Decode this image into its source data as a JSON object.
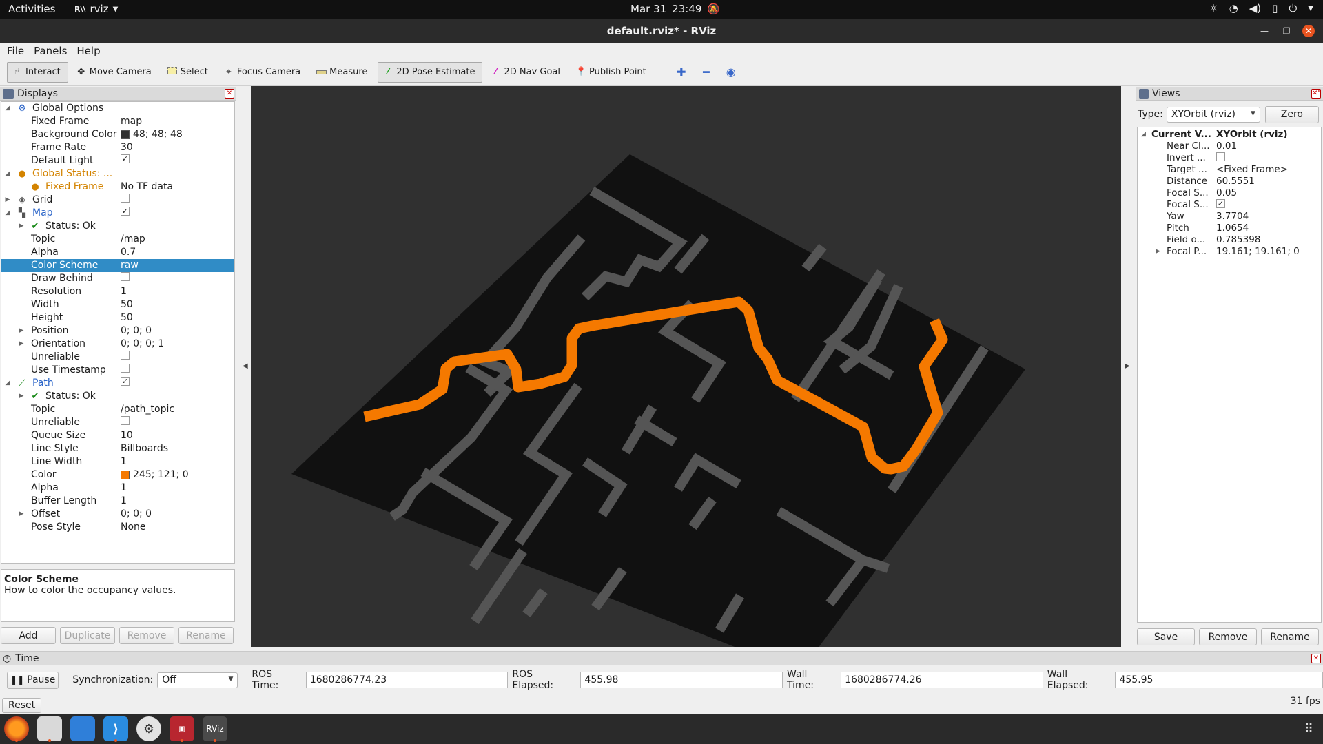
{
  "system": {
    "activities": "Activities",
    "app_name": "rviz",
    "date": "Mar 31",
    "time": "23:49"
  },
  "window": {
    "title": "default.rviz* - RViz"
  },
  "menu": [
    "File",
    "Panels",
    "Help"
  ],
  "toolbar": {
    "tools": [
      {
        "label": "Interact",
        "icon": "hand-icon"
      },
      {
        "label": "Move Camera",
        "icon": "move-camera-icon"
      },
      {
        "label": "Select",
        "icon": "select-icon"
      },
      {
        "label": "Focus Camera",
        "icon": "focus-camera-icon"
      },
      {
        "label": "Measure",
        "icon": "ruler-icon"
      },
      {
        "label": "2D Pose Estimate",
        "icon": "pose-estimate-icon"
      },
      {
        "label": "2D Nav Goal",
        "icon": "nav-goal-icon"
      },
      {
        "label": "Publish Point",
        "icon": "map-pin-icon"
      }
    ]
  },
  "displays": {
    "title": "Displays",
    "rows": [
      {
        "label": "Global Options",
        "value": ""
      },
      {
        "label": "Fixed Frame",
        "value": "map"
      },
      {
        "label": "Background Color",
        "value": "48; 48; 48"
      },
      {
        "label": "Frame Rate",
        "value": "30"
      },
      {
        "label": "Default Light",
        "value": ""
      },
      {
        "label": "Global Status: ...",
        "value": ""
      },
      {
        "label": "Fixed Frame",
        "value": "No TF data"
      },
      {
        "label": "Grid",
        "value": ""
      },
      {
        "label": "Map",
        "value": ""
      },
      {
        "label": "Status: Ok",
        "value": ""
      },
      {
        "label": "Topic",
        "value": "/map"
      },
      {
        "label": "Alpha",
        "value": "0.7"
      },
      {
        "label": "Color Scheme",
        "value": "raw"
      },
      {
        "label": "Draw Behind",
        "value": ""
      },
      {
        "label": "Resolution",
        "value": "1"
      },
      {
        "label": "Width",
        "value": "50"
      },
      {
        "label": "Height",
        "value": "50"
      },
      {
        "label": "Position",
        "value": "0; 0; 0"
      },
      {
        "label": "Orientation",
        "value": "0; 0; 0; 1"
      },
      {
        "label": "Unreliable",
        "value": ""
      },
      {
        "label": "Use Timestamp",
        "value": ""
      },
      {
        "label": "Path",
        "value": ""
      },
      {
        "label": "Status: Ok",
        "value": ""
      },
      {
        "label": "Topic",
        "value": "/path_topic"
      },
      {
        "label": "Unreliable",
        "value": ""
      },
      {
        "label": "Queue Size",
        "value": "10"
      },
      {
        "label": "Line Style",
        "value": "Billboards"
      },
      {
        "label": "Line Width",
        "value": "1"
      },
      {
        "label": "Color",
        "value": "245; 121; 0"
      },
      {
        "label": "Alpha",
        "value": "1"
      },
      {
        "label": "Buffer Length",
        "value": "1"
      },
      {
        "label": "Offset",
        "value": "0; 0; 0"
      },
      {
        "label": "Pose Style",
        "value": "None"
      }
    ],
    "description": {
      "title": "Color Scheme",
      "text": "How to color the occupancy values."
    },
    "buttons": [
      "Add",
      "Duplicate",
      "Remove",
      "Rename"
    ]
  },
  "colors": {
    "background": "#303030",
    "path": "#f57900",
    "selection": "#308cc6"
  },
  "views": {
    "title": "Views",
    "type_label": "Type:",
    "type_value": "XYOrbit (rviz)",
    "zero_label": "Zero",
    "rows": [
      {
        "label": "Current V...",
        "value": "XYOrbit (rviz)"
      },
      {
        "label": "Near Cl...",
        "value": "0.01"
      },
      {
        "label": "Invert ...",
        "value": ""
      },
      {
        "label": "Target ...",
        "value": "<Fixed Frame>"
      },
      {
        "label": "Distance",
        "value": "60.5551"
      },
      {
        "label": "Focal S...",
        "value": "0.05"
      },
      {
        "label": "Focal S...",
        "value": ""
      },
      {
        "label": "Yaw",
        "value": "3.7704"
      },
      {
        "label": "Pitch",
        "value": "1.0654"
      },
      {
        "label": "Field o...",
        "value": "0.785398"
      },
      {
        "label": "Focal P...",
        "value": "19.161; 19.161; 0"
      }
    ],
    "buttons": [
      "Save",
      "Remove",
      "Rename"
    ]
  },
  "time": {
    "title": "Time",
    "pause_label": "Pause",
    "sync_label": "Synchronization:",
    "sync_value": "Off",
    "ros_time_label": "ROS Time:",
    "ros_time": "1680286774.23",
    "ros_elapsed_label": "ROS Elapsed:",
    "ros_elapsed": "455.98",
    "wall_time_label": "Wall Time:",
    "wall_time": "1680286774.26",
    "wall_elapsed_label": "Wall Elapsed:",
    "wall_elapsed": "455.95",
    "reset_label": "Reset",
    "fps": "31 fps"
  },
  "dock": {
    "rviz_label": "RViz"
  }
}
